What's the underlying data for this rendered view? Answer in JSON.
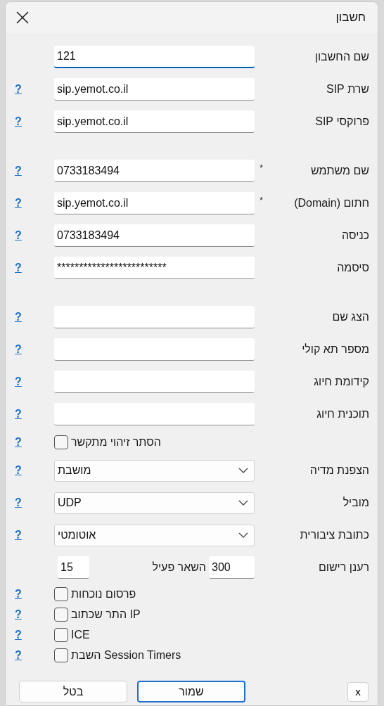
{
  "window": {
    "title": "חשבון"
  },
  "sections": [
    {
      "rows": [
        {
          "kind": "text",
          "label": "שם החשבון",
          "value": "121",
          "focused": true
        },
        {
          "kind": "text",
          "label": "שרת SIP",
          "value": "sip.yemot.co.il",
          "help": "?",
          "focused": false
        },
        {
          "kind": "text",
          "label": "פרוקסי SIP",
          "value": "sip.yemot.co.il",
          "help": "?",
          "focused": false
        }
      ]
    },
    {
      "rows": [
        {
          "kind": "text",
          "label": "שם משתמש",
          "required_mark": "*",
          "value": "0733183494",
          "help": "?",
          "focused": false
        },
        {
          "kind": "text",
          "label": "חתום (Domain)",
          "required_mark": "*",
          "value": "sip.yemot.co.il",
          "help": "?",
          "focused": false
        },
        {
          "kind": "text",
          "label": "כניסה",
          "value": "0733183494",
          "help": "?",
          "focused": false
        },
        {
          "kind": "text",
          "label": "סיסמה",
          "value": "*************************",
          "help": "?",
          "focused": false
        }
      ]
    },
    {
      "rows": [
        {
          "kind": "text",
          "label": "הצג שם",
          "value": "",
          "help": "?",
          "focused": false
        },
        {
          "kind": "text",
          "label": "מספר תא קולי",
          "value": "",
          "help": "?",
          "focused": false
        },
        {
          "kind": "text",
          "label": "קידומת חיוג",
          "value": "",
          "help": "?",
          "focused": false
        },
        {
          "kind": "text",
          "label": "תוכנית חיוג",
          "value": "",
          "help": "?",
          "focused": false
        },
        {
          "kind": "check",
          "label": "הסתר זיהוי מתקשר",
          "checked": false,
          "help": "?"
        },
        {
          "kind": "select",
          "label": "הצפנת מדיה",
          "value": "מושבת",
          "help": "?"
        },
        {
          "kind": "select",
          "label": "מוביל",
          "value": "UDP",
          "help": "?"
        },
        {
          "kind": "select",
          "label": "כתובת ציבורית",
          "value": "אוטומטי",
          "help": "?"
        },
        {
          "kind": "refresh",
          "label": "רענן רישום",
          "value": "300",
          "inline_label": "השאר פעיל",
          "value_2": "15"
        },
        {
          "kind": "option",
          "label": "פרסום נוכחות",
          "checked": false,
          "help": "?"
        },
        {
          "kind": "option",
          "label": "התר שכתוב IP",
          "checked": false,
          "help": "?"
        },
        {
          "kind": "option",
          "label": "ICE",
          "checked": false,
          "help": "?"
        },
        {
          "kind": "option",
          "label": "השבת Session Timers",
          "checked": false,
          "help": "?"
        }
      ]
    }
  ],
  "small_button": "x",
  "buttons": [
    {
      "label": "שמור",
      "default": true
    },
    {
      "label": "בטל",
      "default": false
    }
  ]
}
